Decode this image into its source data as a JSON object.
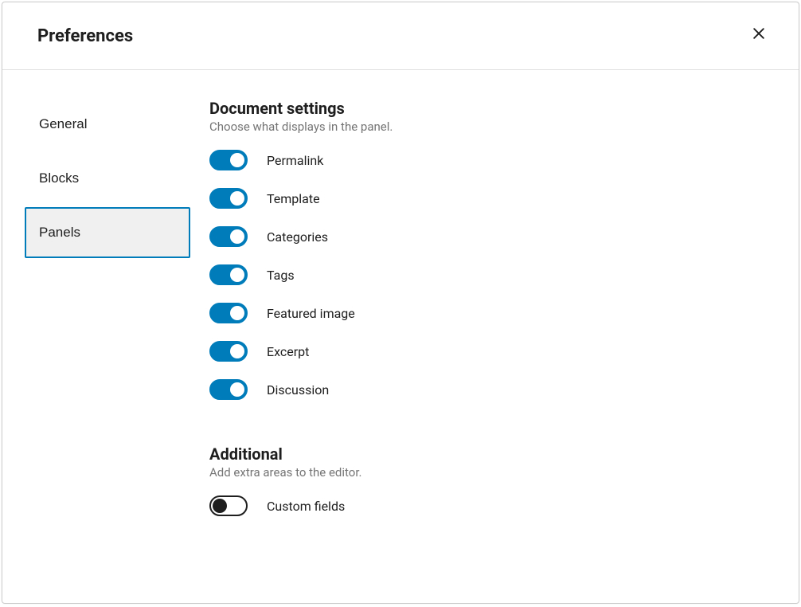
{
  "header": {
    "title": "Preferences"
  },
  "sidebar": {
    "items": [
      {
        "label": "General",
        "active": false
      },
      {
        "label": "Blocks",
        "active": false
      },
      {
        "label": "Panels",
        "active": true
      }
    ]
  },
  "sections": {
    "document": {
      "title": "Document settings",
      "description": "Choose what displays in the panel.",
      "toggles": [
        {
          "label": "Permalink",
          "on": true
        },
        {
          "label": "Template",
          "on": true
        },
        {
          "label": "Categories",
          "on": true
        },
        {
          "label": "Tags",
          "on": true
        },
        {
          "label": "Featured image",
          "on": true
        },
        {
          "label": "Excerpt",
          "on": true
        },
        {
          "label": "Discussion",
          "on": true
        }
      ]
    },
    "additional": {
      "title": "Additional",
      "description": "Add extra areas to the editor.",
      "toggles": [
        {
          "label": "Custom fields",
          "on": false
        }
      ]
    }
  }
}
